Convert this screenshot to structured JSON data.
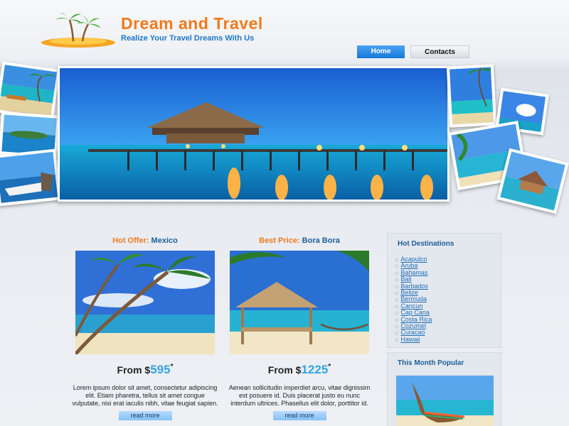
{
  "header": {
    "title": "Dream and Travel",
    "tagline": "Realize Your Travel Dreams With Us"
  },
  "nav": {
    "home": "Home",
    "contacts": "Contacts"
  },
  "offers": [
    {
      "label": "Hot Offer:",
      "place": "Mexico",
      "price_prefix": "From $",
      "price": "595",
      "price_mark": "*",
      "description": "Lorem ipsum dolor sit amet, consectetur adipiscing elit. Etiam pharetra, tellus sit amet congue vulputate, nisi erat iaculis nibh, vitae feugiat sapien.",
      "button": "read more"
    },
    {
      "label": "Best Price:",
      "place": "Bora Bora",
      "price_prefix": "From $",
      "price": "1225",
      "price_mark": "*",
      "description": "Aenean sollicitudin imperdiet arcu, vitae dignissim est posuere id. Duis placerat justo eu nunc interdum ultrices. Phasellus elit dolor, porttitor id.",
      "button": "read more"
    }
  ],
  "sidebar": {
    "hot_destinations_title": "Hot Destinations",
    "destinations": [
      "Acapulco",
      "Aruba",
      "Bahamas",
      "Bali",
      "Barbados",
      "Belize",
      "Bermuda",
      "Cancun",
      "Cap Cana",
      "Costa Rica",
      "Cozumel",
      "Curacao",
      "Hawaii"
    ],
    "popular_title": "This Month Popular"
  },
  "colors": {
    "accent_orange": "#f07a1c",
    "brand_blue": "#1f78c8",
    "price_blue": "#35a4e0"
  }
}
